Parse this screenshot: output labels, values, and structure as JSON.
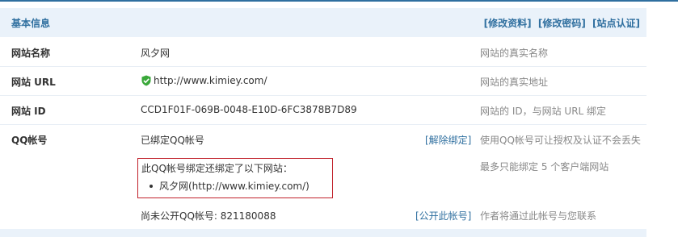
{
  "header": {
    "title": "基本信息",
    "links": [
      "[修改资料]",
      "[修改密码]",
      "[站点认证]"
    ]
  },
  "rows": [
    {
      "label": "网站名称",
      "value": "风夕网",
      "hint": "网站的真实名称"
    },
    {
      "label": "网站 URL",
      "value": "http://www.kimiey.com/",
      "hint": "网站的真实地址",
      "icon": "verified-shield-icon"
    },
    {
      "label": "网站 ID",
      "value": "CCD1F01F-069B-0048-E10D-6FC3878B7D89",
      "hint": "网站的 ID，与网站 URL 绑定"
    }
  ],
  "qq": {
    "label": "QQ帐号",
    "bound_text": "已绑定QQ帐号",
    "unbind_action": "[解除绑定]",
    "hint": "使用QQ帐号可让授权及认证不会丢失",
    "bound_sites_title": "此QQ帐号绑定还绑定了以下网站：",
    "bound_sites": [
      "风夕网(http://www.kimiey.com/)"
    ],
    "bound_sites_hint": "最多只能绑定 5 个客户端网站",
    "unpublished_text": "尚未公开QQ帐号: 821180088",
    "publish_action": "[公开此帐号]",
    "publish_hint": "作者将通过此帐号与您联系"
  },
  "colors": {
    "accent": "#2f6f9f",
    "header_bg": "#eaf2fa",
    "highlight_border": "#c0202a",
    "verified_green": "#3aa83a"
  }
}
